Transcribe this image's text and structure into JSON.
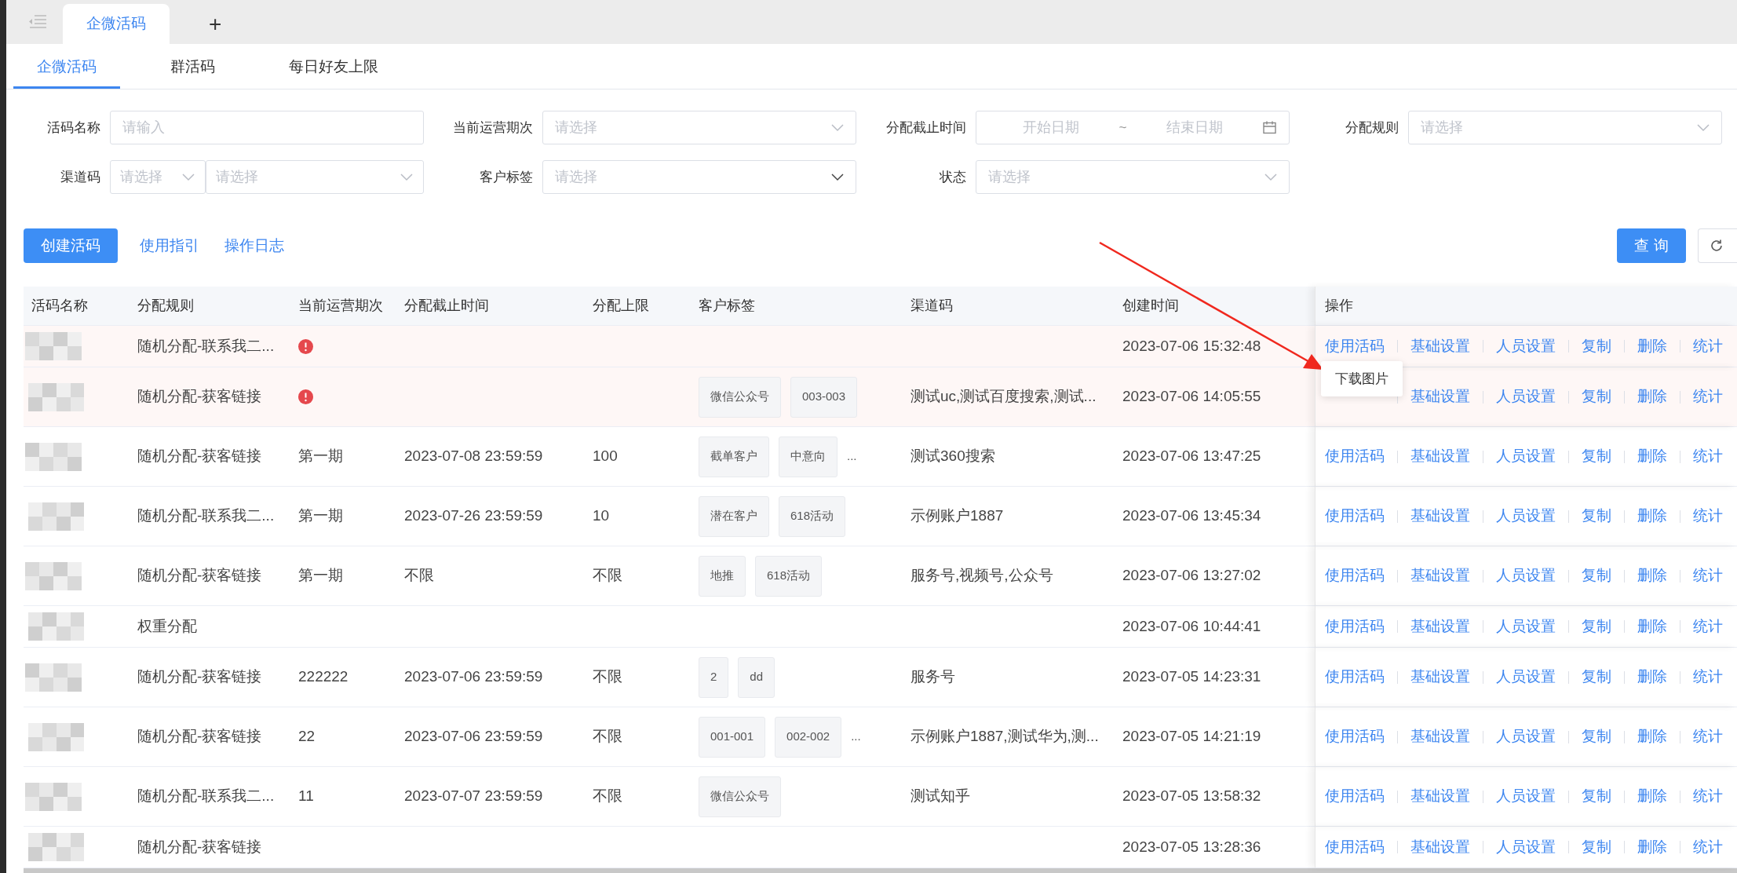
{
  "tab_bar": {
    "tabs": [
      {
        "label": "企微活码",
        "selected": true
      }
    ],
    "add": "+"
  },
  "sub_tabs": [
    {
      "label": "企微活码",
      "selected": true
    },
    {
      "label": "群活码",
      "selected": false
    },
    {
      "label": "每日好友上限",
      "selected": false
    }
  ],
  "filters": [
    {
      "kind": "input",
      "label": "活码名称",
      "placeholder": "请输入"
    },
    {
      "kind": "select",
      "label": "当前运营期次",
      "placeholder": "请选择"
    },
    {
      "kind": "daterange",
      "label": "分配截止时间",
      "start_placeholder": "开始日期",
      "separator": "~",
      "end_placeholder": "结束日期"
    },
    {
      "kind": "select",
      "label": "分配规则",
      "placeholder": "请选择"
    },
    {
      "kind": "cascade",
      "label": "渠道码",
      "placeholders": [
        "请选择",
        "请选择"
      ]
    },
    {
      "kind": "select",
      "label": "客户标签",
      "placeholder": "请选择"
    },
    {
      "kind": "select",
      "label": "状态",
      "placeholder": "请选择"
    }
  ],
  "toolbar": {
    "create": "创建活码",
    "links": [
      "使用指引",
      "操作日志"
    ],
    "query": "查 询"
  },
  "table": {
    "columns": [
      "活码名称",
      "分配规则",
      "当前运营期次",
      "分配截止时间",
      "分配上限",
      "客户标签",
      "渠道码",
      "创建时间",
      "操作"
    ],
    "rows": [
      {
        "rule": "随机分配-联系我二...",
        "warning": true,
        "created": "2023-07-06 15:32:48",
        "actions": [
          "使用活码",
          "基础设置",
          "人员设置",
          "复制",
          "删除",
          "统计"
        ]
      },
      {
        "rule": "随机分配-获客链接",
        "warning": true,
        "tags": [
          "微信公众号",
          "003-003"
        ],
        "channel": "测试uc,测试百度搜索,测试...",
        "created": "2023-07-06 14:05:55",
        "popup": "下载图片",
        "actions": [
          "基础设置",
          "人员设置",
          "复制",
          "删除",
          "统计"
        ]
      },
      {
        "rule": "随机分配-获客链接",
        "warning": false,
        "period": "第一期",
        "deadline": "2023-07-08 23:59:59",
        "limit": "100",
        "tags": [
          "截单客户",
          "中意向"
        ],
        "tags_more": "...",
        "channel": "测试360搜索",
        "created": "2023-07-06 13:47:25",
        "actions": [
          "使用活码",
          "基础设置",
          "人员设置",
          "复制",
          "删除",
          "统计"
        ]
      },
      {
        "rule": "随机分配-联系我二...",
        "warning": false,
        "period": "第一期",
        "deadline": "2023-07-26 23:59:59",
        "limit": "10",
        "tags": [
          "潜在客户",
          "618活动"
        ],
        "channel": "示例账户1887",
        "created": "2023-07-06 13:45:34",
        "actions": [
          "使用活码",
          "基础设置",
          "人员设置",
          "复制",
          "删除",
          "统计"
        ]
      },
      {
        "rule": "随机分配-获客链接",
        "warning": false,
        "period": "第一期",
        "deadline": "不限",
        "limit": "不限",
        "tags": [
          "地推",
          "618活动"
        ],
        "channel": "服务号,视频号,公众号",
        "created": "2023-07-06 13:27:02",
        "actions": [
          "使用活码",
          "基础设置",
          "人员设置",
          "复制",
          "删除",
          "统计"
        ]
      },
      {
        "rule": "权重分配",
        "warning": false,
        "created": "2023-07-06 10:44:41",
        "actions": [
          "使用活码",
          "基础设置",
          "人员设置",
          "复制",
          "删除",
          "统计"
        ]
      },
      {
        "rule": "随机分配-获客链接",
        "warning": false,
        "period": "222222",
        "deadline": "2023-07-06 23:59:59",
        "limit": "不限",
        "tags": [
          "2",
          "dd"
        ],
        "channel": "服务号",
        "created": "2023-07-05 14:23:31",
        "actions": [
          "使用活码",
          "基础设置",
          "人员设置",
          "复制",
          "删除",
          "统计"
        ]
      },
      {
        "rule": "随机分配-获客链接",
        "warning": false,
        "period": "22",
        "deadline": "2023-07-06 23:59:59",
        "limit": "不限",
        "tags": [
          "001-001",
          "002-002"
        ],
        "tags_more": "...",
        "channel": "示例账户1887,测试华为,测...",
        "created": "2023-07-05 14:21:19",
        "actions": [
          "使用活码",
          "基础设置",
          "人员设置",
          "复制",
          "删除",
          "统计"
        ]
      },
      {
        "rule": "随机分配-联系我二...",
        "warning": false,
        "period": "11",
        "deadline": "2023-07-07 23:59:59",
        "limit": "不限",
        "tags": [
          "微信公众号"
        ],
        "channel": "测试知乎",
        "created": "2023-07-05 13:58:32",
        "actions": [
          "使用活码",
          "基础设置",
          "人员设置",
          "复制",
          "删除",
          "统计"
        ]
      },
      {
        "rule": "随机分配-获客链接",
        "warning": false,
        "created": "2023-07-05 13:28:36",
        "actions": [
          "使用活码",
          "基础设置",
          "人员设置",
          "复制",
          "删除",
          "统计"
        ]
      }
    ]
  }
}
